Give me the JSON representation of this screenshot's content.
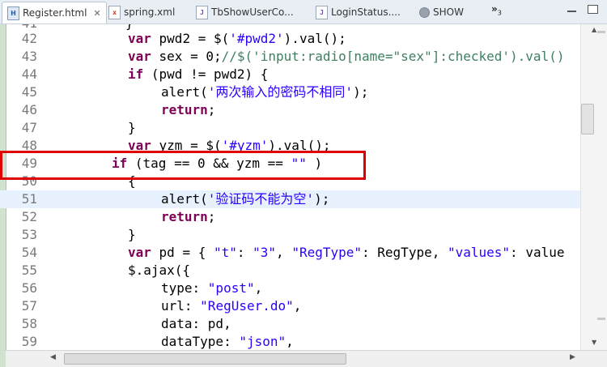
{
  "tabs": [
    {
      "label": "Register.html",
      "icon": "html-file-icon",
      "active": true
    },
    {
      "label": "spring.xml",
      "icon": "xml-file-icon"
    },
    {
      "label": "TbShowUserCo...",
      "icon": "java-file-icon"
    },
    {
      "label": "LoginStatus....",
      "icon": "java-file-icon"
    },
    {
      "label": "SHOW",
      "icon": "globe-icon"
    }
  ],
  "overflow_indicator": "»",
  "overflow_count": "3",
  "editor": {
    "lines": [
      {
        "n": "41",
        "code": "            }"
      },
      {
        "n": "42",
        "code": "var pwd2 = $('#pwd2').val();"
      },
      {
        "n": "43",
        "code": "var sex = 0;//$('input:radio[name=\"sex\"]:checked').val()"
      },
      {
        "n": "44",
        "code": "if (pwd != pwd2) {"
      },
      {
        "n": "45",
        "code": "alert('两次输入的密码不相同');"
      },
      {
        "n": "46",
        "code": "return;"
      },
      {
        "n": "47",
        "code": "}"
      },
      {
        "n": "48",
        "code": "var yzm = $('#yzm').val();"
      },
      {
        "n": "49",
        "code": "if (tag == 0 && yzm == \"\" )"
      },
      {
        "n": "50",
        "code": "{"
      },
      {
        "n": "51",
        "code": "alert('验证码不能为空');"
      },
      {
        "n": "52",
        "code": "return;"
      },
      {
        "n": "53",
        "code": "}"
      },
      {
        "n": "54",
        "code": "var pd = { \"t\": \"3\", \"RegType\": RegType, \"values\": value"
      },
      {
        "n": "55",
        "code": "$.ajax({"
      },
      {
        "n": "56",
        "code": "type: \"post\","
      },
      {
        "n": "57",
        "code": "url: \"RegUser.do\","
      },
      {
        "n": "58",
        "code": "data: pd,"
      },
      {
        "n": "59",
        "code": "dataType: \"json\","
      }
    ]
  },
  "colors": {
    "keyword": "#7f0055",
    "string": "#2a00ff",
    "comment": "#3f7f5f",
    "highlight_box": "#e00000",
    "current_line": "#e8f2fe"
  }
}
